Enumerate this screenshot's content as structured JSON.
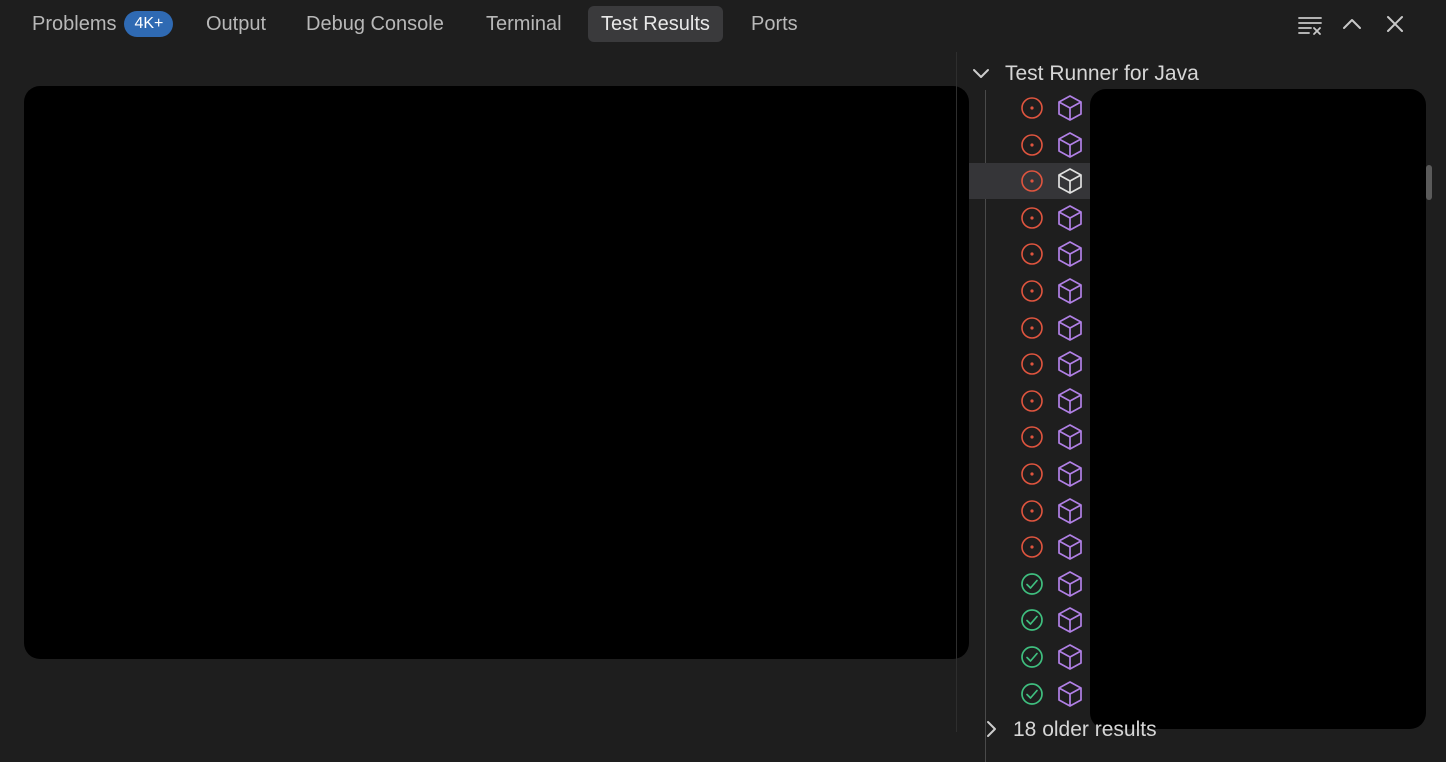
{
  "tabs": [
    {
      "label": "Problems",
      "badge": "4K+"
    },
    {
      "label": "Output"
    },
    {
      "label": "Debug Console"
    },
    {
      "label": "Terminal"
    },
    {
      "label": "Test Results",
      "active": true
    },
    {
      "label": "Ports"
    }
  ],
  "actions": [
    "clear-output-icon",
    "chevron-up-icon",
    "close-icon"
  ],
  "colors": {
    "background": "#1e1e1e",
    "badge": "#2f6ab3",
    "failed": "#e0553f",
    "passed": "#3fbf7f",
    "package": "#b180e6"
  },
  "test_tree": {
    "header": "Test Runner for Java",
    "items": [
      {
        "status": "failed"
      },
      {
        "status": "failed"
      },
      {
        "status": "failed",
        "selected": true
      },
      {
        "status": "failed"
      },
      {
        "status": "failed"
      },
      {
        "status": "failed"
      },
      {
        "status": "failed"
      },
      {
        "status": "failed"
      },
      {
        "status": "failed"
      },
      {
        "status": "failed"
      },
      {
        "status": "failed"
      },
      {
        "status": "failed"
      },
      {
        "status": "failed"
      },
      {
        "status": "passed"
      },
      {
        "status": "passed"
      },
      {
        "status": "passed"
      },
      {
        "status": "passed"
      }
    ],
    "older_label": "18 older results"
  }
}
